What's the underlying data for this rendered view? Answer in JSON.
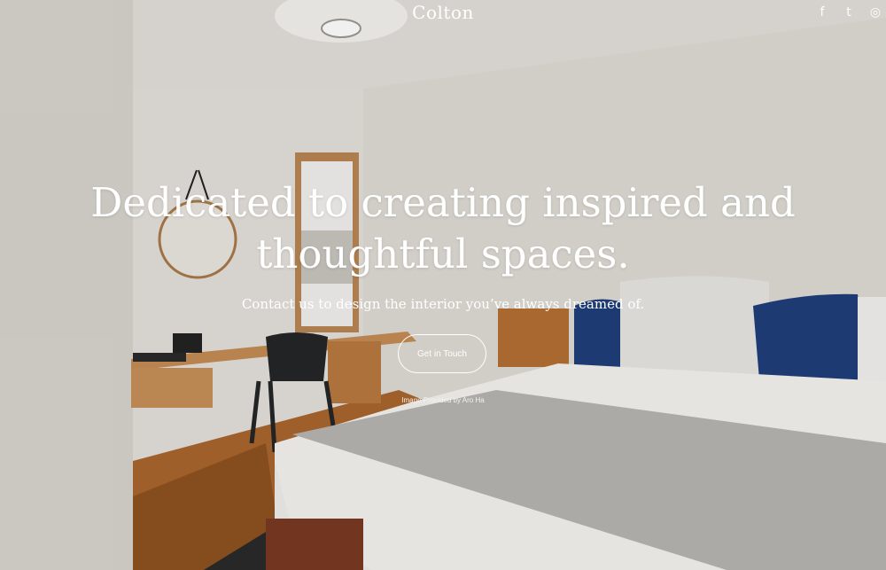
{
  "site": {
    "title": "Colton"
  },
  "social": [
    {
      "name": "facebook-icon",
      "glyph": "f"
    },
    {
      "name": "twitter-icon",
      "glyph": "t"
    },
    {
      "name": "instagram-icon",
      "glyph": "◎"
    }
  ],
  "hero": {
    "headline_line1": "Dedicated to creating inspired and",
    "headline_line2": "thoughtful spaces.",
    "subtitle": "Contact us to design the interior you’ve always dreamed of.",
    "cta_label": "Get in Touch",
    "credit": "Image Provided by Aro Ha"
  },
  "colors": {
    "text": "#ffffff",
    "wall": "#e2dfd9",
    "wood": "#b87a45",
    "pillow_blue": "#1f3f7a"
  }
}
